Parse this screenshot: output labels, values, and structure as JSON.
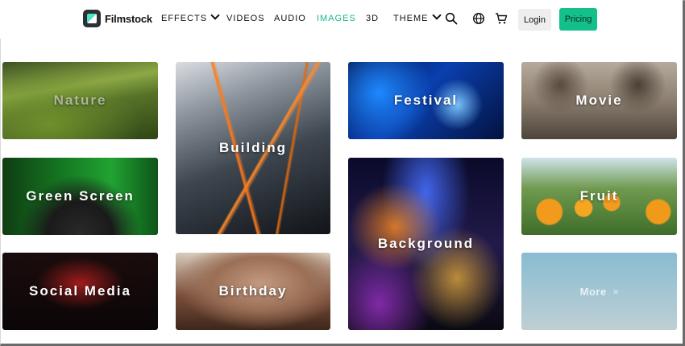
{
  "brand": {
    "name": "Filmstock"
  },
  "nav": {
    "effects": "EFFECTS",
    "videos": "VIDEOS",
    "audio": "AUDIO",
    "images": "IMAGES",
    "three_d": "3D",
    "theme": "THEME",
    "login": "Login",
    "pricing": "Pricing",
    "active_item": "IMAGES"
  },
  "icons": {
    "search": "search-icon",
    "language": "globe-icon",
    "cart": "cart-icon",
    "dropdown": "chevron-down-icon",
    "more": "double-chevron-right-icon"
  },
  "categories": {
    "nature": "Nature",
    "building": "Building",
    "festival": "Festival",
    "movie": "Movie",
    "green_screen": "Green Screen",
    "background": "Background",
    "fruit": "Fruit",
    "social_media": "Social Media",
    "birthday": "Birthday",
    "more": "More"
  },
  "colors": {
    "accent": "#13c08c",
    "active_nav": "#15b68a",
    "login_bg": "#eeeeee",
    "text": "#111111"
  }
}
